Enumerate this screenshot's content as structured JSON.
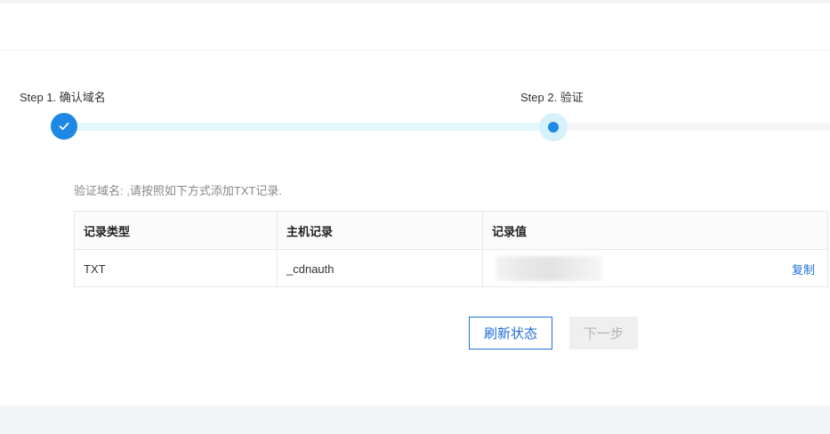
{
  "steps": [
    {
      "label": "Step 1. 确认域名",
      "state": "done"
    },
    {
      "label": "Step 2. 验证",
      "state": "active"
    }
  ],
  "hint": "验证域名: ,请按照如下方式添加TXT记录.",
  "table": {
    "headers": [
      "记录类型",
      "主机记录",
      "记录值"
    ],
    "rows": [
      {
        "type": "TXT",
        "host": "_cdnauth",
        "value": "",
        "action": "复制"
      }
    ]
  },
  "buttons": {
    "refresh": "刷新状态",
    "next": "下一步"
  },
  "colors": {
    "accent": "#1e88e5",
    "link": "#1e6fd9",
    "progress_done": "#e2f8fb",
    "disabled_bg": "#efefef"
  },
  "icons": {
    "step1": "check-icon",
    "step2": "current-step-dot-icon"
  }
}
